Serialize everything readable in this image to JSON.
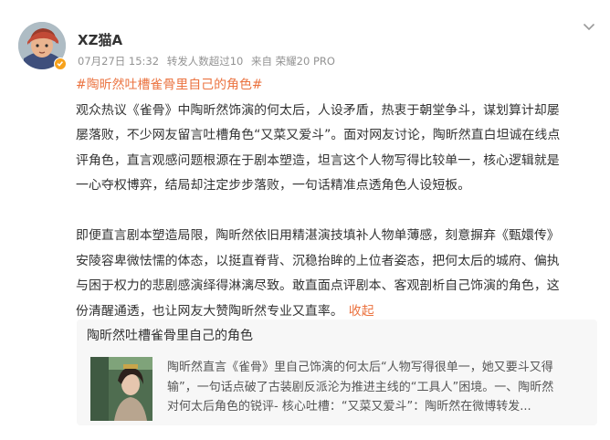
{
  "post": {
    "username": "XZ猫A",
    "date": "07月27日 15:32",
    "reposts": "转发人数超过10",
    "source": "来自 荣耀20 PRO",
    "topic": "#陶昕然吐槽雀骨里自己的角色#",
    "body_lines": [
      "观众热议《雀骨》中陶昕然饰演的何太后，人设矛盾，热衷于朝堂争斗，谋划算计却屡",
      "屡落败，不少网友留言吐槽角色“又菜又爱斗”。面对网友讨论，陶昕然直白坦诚在线点",
      "评角色，直言观感问题根源在于剧本塑造，坦言这个人物写得比较单一，核心逻辑就是",
      "一心夺权博弈，结局却注定步步落败，一句话精准点透角色人设短板。"
    ],
    "body_lines_2": [
      "即便直言剧本塑造局限，陶昕然依旧用精湛演技填补人物单薄感，刻意摒弃《甄嬛传》",
      "安陵容卑微怯懦的体态，以挺直脊背、沉稳抬眸的上位者姿态，把何太后的城府、偏执",
      "与困于权力的悲剧感演绎得淋漓尽致。敢直面点评剧本、客观剖析自己饰演的角色，这",
      "份清醒通透，也让网友大赞陶昕然专业又直率。"
    ],
    "collapse_label": "收起",
    "card": {
      "title": "陶昕然吐槽雀骨里自己的角色",
      "desc_lines": [
        "陶昕然直言《雀骨》里自己饰演的何太后“人物写得很单一，她又要斗又得",
        "输”，一句话点破了古装剧反派沦为推进主线的“工具人”困境。一、陶昕然",
        "对何太后角色的锐评- 核心吐槽：“又菜又爱斗”：陶昕然在微博转发..."
      ]
    }
  },
  "colors": {
    "accent": "#eb7340",
    "verified": "#f7a21c",
    "meta": "#939393"
  },
  "icons": {
    "more": "chevron-down-icon",
    "verified": "verified-badge-icon"
  }
}
